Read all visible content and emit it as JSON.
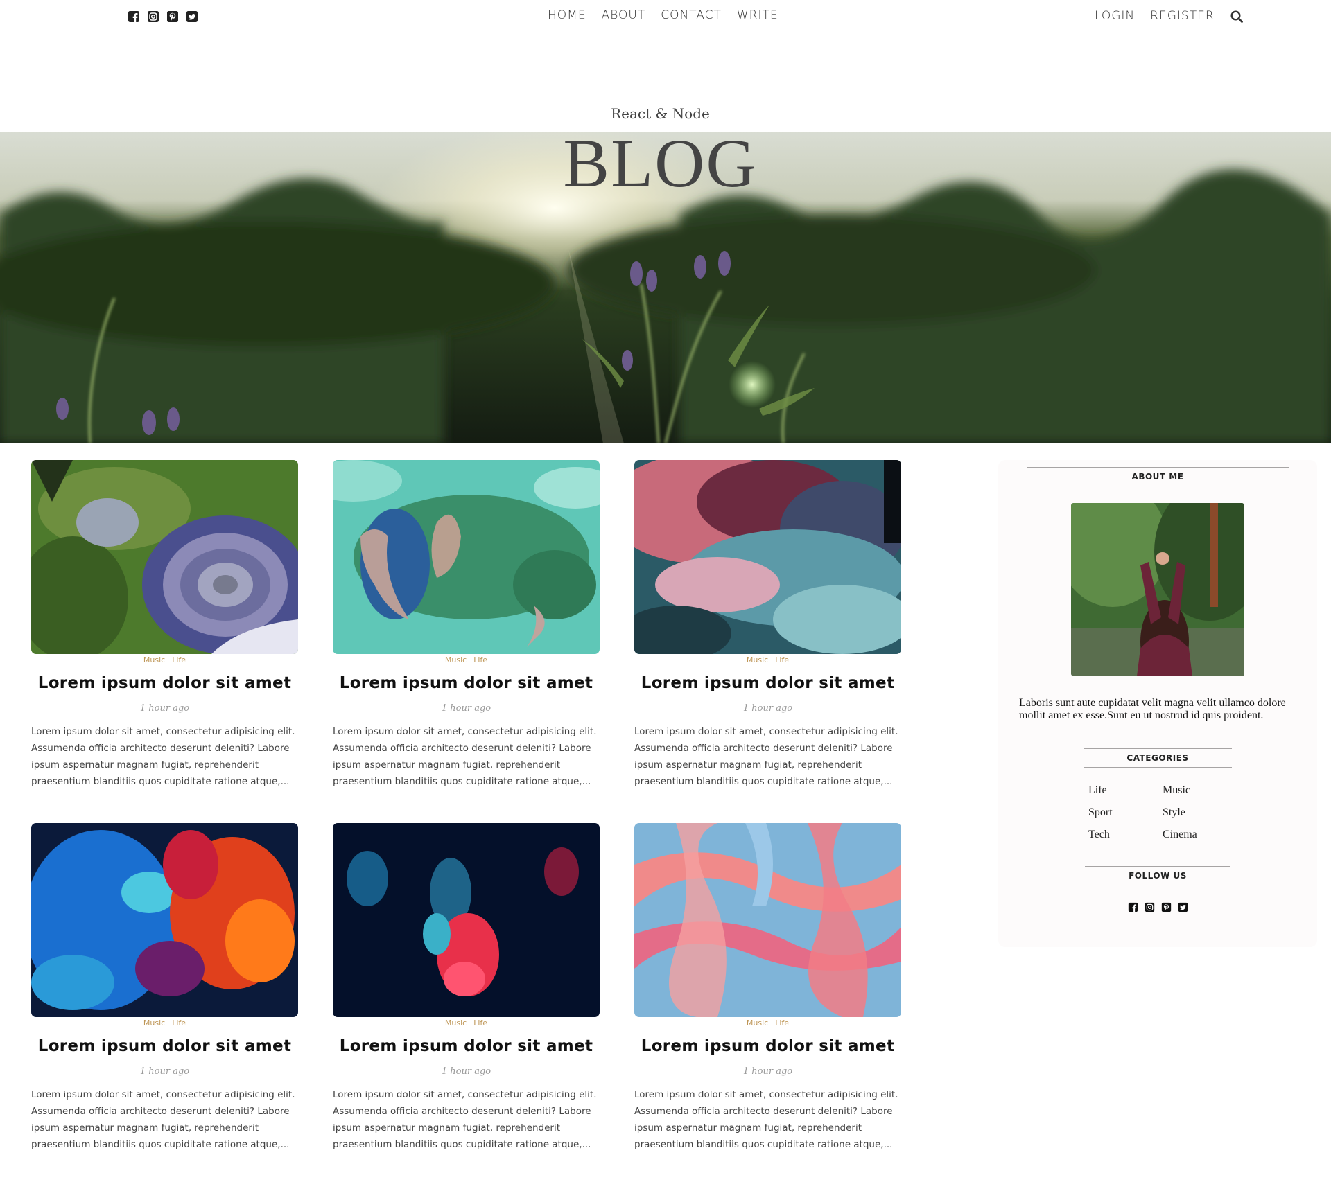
{
  "nav": {
    "social": [
      "facebook-icon",
      "instagram-icon",
      "pinterest-icon",
      "twitter-icon"
    ],
    "links": [
      "HOME",
      "ABOUT",
      "CONTACT",
      "WRITE"
    ],
    "auth": [
      "LOGIN",
      "REGISTER"
    ],
    "search_icon": "search-icon"
  },
  "header": {
    "subtitle": "React & Node",
    "title": "BLOG"
  },
  "posts": [
    {
      "categories": [
        "Music",
        "Life"
      ],
      "title": "Lorem ipsum dolor sit amet",
      "date": "1 hour ago",
      "desc": "Lorem ipsum dolor sit amet, consectetur adipisicing elit. Assumenda officia architecto deserunt deleniti? Labore ipsum aspernatur magnam fugiat, reprehenderit praesentium blanditiis quos cupiditate ratione atque,...",
      "image": "satellite-green-crater"
    },
    {
      "categories": [
        "Music",
        "Life"
      ],
      "title": "Lorem ipsum dolor sit amet",
      "date": "1 hour ago",
      "desc": "Lorem ipsum dolor sit amet, consectetur adipisicing elit. Assumenda officia architecto deserunt deleniti? Labore ipsum aspernatur magnam fugiat, reprehenderit praesentium blanditiis quos cupiditate ratione atque,...",
      "image": "satellite-turquoise-islands"
    },
    {
      "categories": [
        "Music",
        "Life"
      ],
      "title": "Lorem ipsum dolor sit amet",
      "date": "1 hour ago",
      "desc": "Lorem ipsum dolor sit amet, consectetur adipisicing elit. Assumenda officia architecto deserunt deleniti? Labore ipsum aspernatur magnam fugiat, reprehenderit praesentium blanditiis quos cupiditate ratione atque,...",
      "image": "pink-teal-smoke"
    },
    {
      "categories": [
        "Music",
        "Life"
      ],
      "title": "Lorem ipsum dolor sit amet",
      "date": "1 hour ago",
      "desc": "Lorem ipsum dolor sit amet, consectetur adipisicing elit. Assumenda officia architecto deserunt deleniti? Labore ipsum aspernatur magnam fugiat, reprehenderit praesentium blanditiis quos cupiditate ratione atque,...",
      "image": "blue-orange-ink"
    },
    {
      "categories": [
        "Music",
        "Life"
      ],
      "title": "Lorem ipsum dolor sit amet",
      "date": "1 hour ago",
      "desc": "Lorem ipsum dolor sit amet, consectetur adipisicing elit. Assumenda officia architecto deserunt deleniti? Labore ipsum aspernatur magnam fugiat, reprehenderit praesentium blanditiis quos cupiditate ratione atque,...",
      "image": "red-ink-dark-water"
    },
    {
      "categories": [
        "Music",
        "Life"
      ],
      "title": "Lorem ipsum dolor sit amet",
      "date": "1 hour ago",
      "desc": "Lorem ipsum dolor sit amet, consectetur adipisicing elit. Assumenda officia architecto deserunt deleniti? Labore ipsum aspernatur magnam fugiat, reprehenderit praesentium blanditiis quos cupiditate ratione atque,...",
      "image": "pink-blue-marble"
    }
  ],
  "sidebar": {
    "about_title": "ABOUT ME",
    "about_text": "Laboris sunt aute cupidatat velit magna velit ullamco dolore mollit amet ex esse.Sunt eu ut nostrud id quis proident.",
    "categories_title": "CATEGORIES",
    "categories": [
      "Life",
      "Music",
      "Sport",
      "Style",
      "Tech",
      "Cinema"
    ],
    "follow_title": "FOLLOW US",
    "social": [
      "facebook-icon",
      "instagram-icon",
      "pinterest-icon",
      "twitter-icon"
    ]
  },
  "colors": {
    "category_accent": "#be9656",
    "sidebar_bg": "#fdfbfb",
    "nav_text": "#333333"
  }
}
